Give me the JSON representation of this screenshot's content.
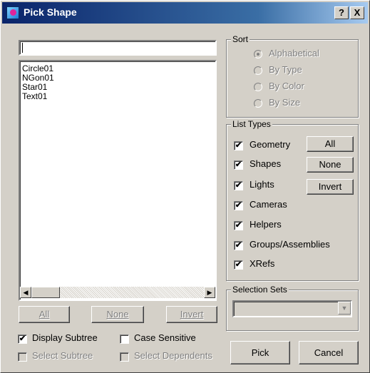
{
  "window": {
    "title": "Pick Shape",
    "help_label": "?",
    "close_label": "X"
  },
  "filter": {
    "value": ""
  },
  "list": {
    "items": [
      "Circle01",
      "NGon01",
      "Star01",
      "Text01"
    ]
  },
  "list_buttons": {
    "all": "All",
    "none": "None",
    "invert": "Invert"
  },
  "options": {
    "display_subtree": "Display Subtree",
    "case_sensitive": "Case Sensitive",
    "select_subtree": "Select Subtree",
    "select_dependents": "Select Dependents"
  },
  "sort": {
    "legend": "Sort",
    "items": [
      "Alphabetical",
      "By Type",
      "By Color",
      "By Size"
    ],
    "selected": "Alphabetical"
  },
  "list_types": {
    "legend": "List Types",
    "items": [
      "Geometry",
      "Shapes",
      "Lights",
      "Cameras",
      "Helpers",
      "Groups/Assemblies",
      "XRefs"
    ],
    "checked_mark": "✔",
    "all": "All",
    "none": "None",
    "invert": "Invert"
  },
  "selection_sets": {
    "legend": "Selection Sets",
    "value": ""
  },
  "actions": {
    "pick": "Pick",
    "cancel": "Cancel"
  }
}
